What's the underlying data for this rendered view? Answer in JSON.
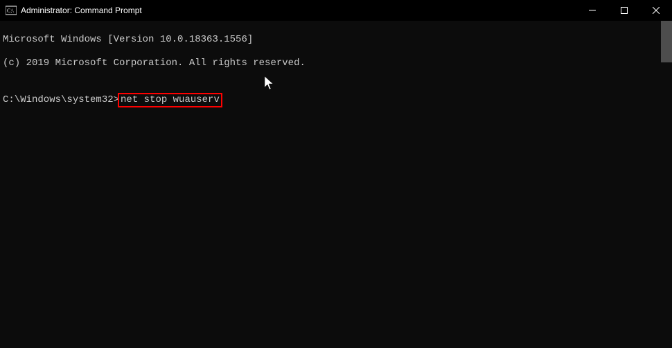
{
  "window": {
    "title": "Administrator: Command Prompt"
  },
  "terminal": {
    "line1": "Microsoft Windows [Version 10.0.18363.1556]",
    "line2": "(c) 2019 Microsoft Corporation. All rights reserved.",
    "blank": "",
    "prompt": "C:\\Windows\\system32>",
    "command": "net stop wuauserv"
  },
  "colors": {
    "highlight_border": "#ff0000",
    "bg": "#0c0c0c",
    "text": "#cccccc"
  }
}
